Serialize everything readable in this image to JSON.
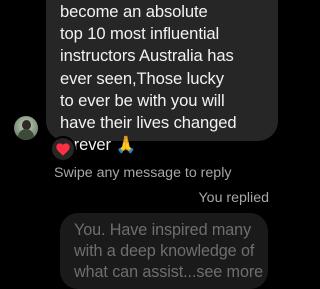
{
  "incoming_message": {
    "text": "become an absolute\ntop 10 most influential\ninstructors Australia has\never seen,Those lucky\nto ever be with you will\nhave their lives changed\nforever 🙏"
  },
  "reaction": {
    "emoji": "heart-icon",
    "color": "#ff3040"
  },
  "swipe_hint": "Swipe any message to reply",
  "reply_label": "You replied",
  "replied_message": {
    "text": "You. Have inspired many\nwith a deep knowledge of\nwhat can assist...see more"
  }
}
